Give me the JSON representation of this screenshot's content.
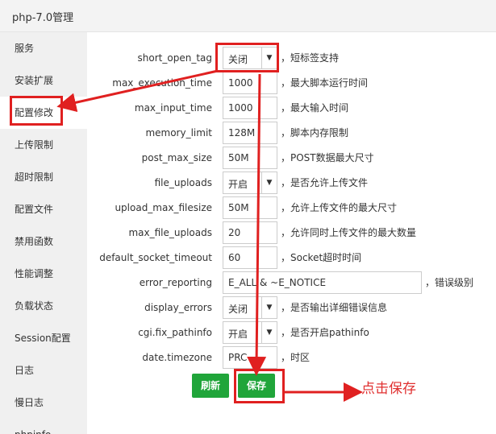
{
  "window": {
    "title": "php-7.0管理"
  },
  "sidebar": {
    "items": [
      {
        "label": "服务"
      },
      {
        "label": "安装扩展"
      },
      {
        "label": "配置修改"
      },
      {
        "label": "上传限制"
      },
      {
        "label": "超时限制"
      },
      {
        "label": "配置文件"
      },
      {
        "label": "禁用函数"
      },
      {
        "label": "性能调整"
      },
      {
        "label": "负载状态"
      },
      {
        "label": "Session配置"
      },
      {
        "label": "日志"
      },
      {
        "label": "慢日志"
      },
      {
        "label": "phpinfo"
      }
    ]
  },
  "config": {
    "short_open_tag": {
      "label": "short_open_tag",
      "value": "关闭",
      "desc": "，短标签支持"
    },
    "max_execution_time": {
      "label": "max_execution_time",
      "value": "1000",
      "desc": "，最大脚本运行时间"
    },
    "max_input_time": {
      "label": "max_input_time",
      "value": "1000",
      "desc": "，最大输入时间"
    },
    "memory_limit": {
      "label": "memory_limit",
      "value": "128M",
      "desc": "，脚本内存限制"
    },
    "post_max_size": {
      "label": "post_max_size",
      "value": "50M",
      "desc": "，POST数据最大尺寸"
    },
    "file_uploads": {
      "label": "file_uploads",
      "value": "开启",
      "desc": "，是否允许上传文件"
    },
    "upload_max_filesize": {
      "label": "upload_max_filesize",
      "value": "50M",
      "desc": "，允许上传文件的最大尺寸"
    },
    "max_file_uploads": {
      "label": "max_file_uploads",
      "value": "20",
      "desc": "，允许同时上传文件的最大数量"
    },
    "default_socket_timeout": {
      "label": "default_socket_timeout",
      "value": "60",
      "desc": "，Socket超时时间"
    },
    "error_reporting": {
      "label": "error_reporting",
      "value": "E_ALL & ~E_NOTICE",
      "desc": "，错误级别"
    },
    "display_errors": {
      "label": "display_errors",
      "value": "关闭",
      "desc": "，是否输出详细错误信息"
    },
    "cgi_fix_pathinfo": {
      "label": "cgi.fix_pathinfo",
      "value": "开启",
      "desc": "，是否开启pathinfo"
    },
    "date_timezone": {
      "label": "date.timezone",
      "value": "PRC",
      "desc": "，时区"
    }
  },
  "buttons": {
    "refresh": "刷新",
    "save": "保存"
  },
  "annotation": {
    "text": "点击保存"
  },
  "icons": {
    "dropdown_caret": "caret-down-icon"
  },
  "colors": {
    "accent_green": "#20a53a",
    "annotation_red": "#e02020"
  }
}
